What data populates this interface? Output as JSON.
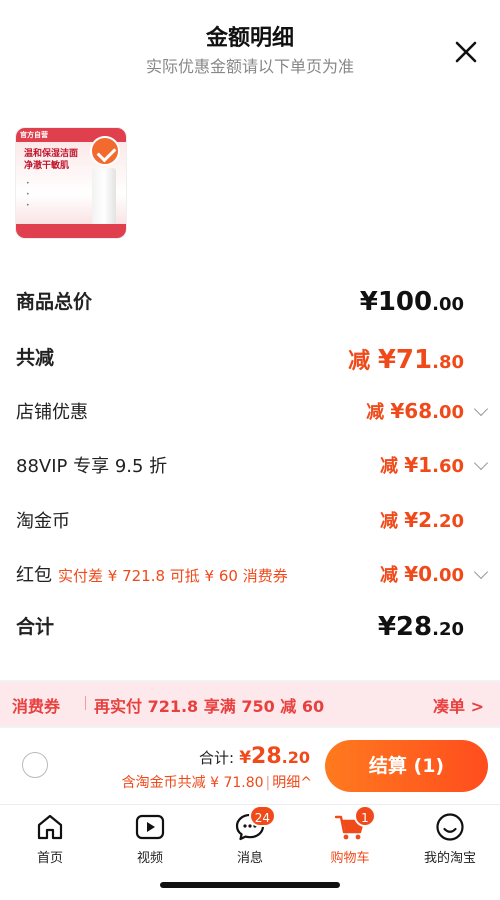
{
  "header": {
    "title": "金额明细",
    "subtitle": "实际优惠金额请以下单页为准"
  },
  "product": {
    "brand_tag": "官方自营",
    "headline": "温和保湿洁面 净澈干敏肌"
  },
  "summary": {
    "total_price": {
      "label": "商品总价",
      "int": "¥100",
      "dec": ".00"
    },
    "total_discount": {
      "label": "共减",
      "prefix": "减 ",
      "int": "¥71",
      "dec": ".80"
    },
    "store_coupon": {
      "label": "店铺优惠",
      "prefix": "减 ",
      "int": "¥68",
      "dec": ".00"
    },
    "vip": {
      "label": "88VIP 专享 9.5 折",
      "prefix": "减 ",
      "int": "¥1",
      "dec": ".60"
    },
    "coins": {
      "label": "淘金币",
      "prefix": "减 ",
      "int": "¥2",
      "dec": ".20"
    },
    "red_packet": {
      "label": "红包",
      "note": "实付差 ¥ 721.8 可抵 ¥ 60 消费券",
      "prefix": "减 ",
      "int": "¥0",
      "dec": ".00"
    },
    "subtotal": {
      "label": "合计",
      "int": "¥28",
      "dec": ".20"
    }
  },
  "promo": {
    "tag": "消费券",
    "text": "再实付 721.8 享满 750 减 60",
    "cta": "凑单 >"
  },
  "checkout": {
    "total_label": "合计:",
    "currency": "¥",
    "total_int": "28",
    "total_dec": ".20",
    "saving_text": "含淘金币共减 ¥ 71.80",
    "detail_link": "明细^",
    "pay_button": "结算 (1)"
  },
  "tabbar": {
    "items": [
      {
        "label": "首页",
        "icon": "home-icon"
      },
      {
        "label": "视频",
        "icon": "video-icon"
      },
      {
        "label": "消息",
        "icon": "message-icon",
        "badge": "24"
      },
      {
        "label": "购物车",
        "icon": "cart-icon",
        "badge": "1",
        "active": true
      },
      {
        "label": "我的淘宝",
        "icon": "profile-icon"
      }
    ]
  },
  "colors": {
    "accent": "#f04a1b",
    "promo_bg": "#fde9ec"
  }
}
